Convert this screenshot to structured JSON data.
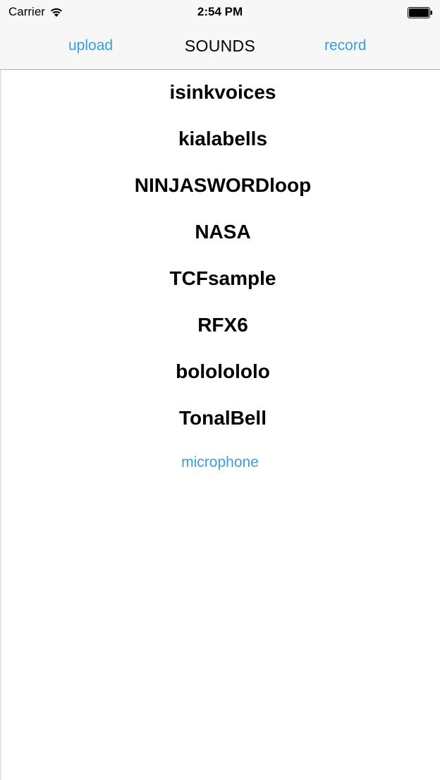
{
  "status_bar": {
    "carrier": "Carrier",
    "time": "2:54 PM",
    "wifi_icon": "wifi-icon",
    "battery_icon": "battery-icon"
  },
  "nav_bar": {
    "left_label": "upload",
    "title": "SOUNDS",
    "right_label": "record"
  },
  "sounds": [
    {
      "name": "isinkvoices"
    },
    {
      "name": "kialabells"
    },
    {
      "name": "NINJASWORDloop"
    },
    {
      "name": "NASA"
    },
    {
      "name": "TCFsample"
    },
    {
      "name": "RFX6"
    },
    {
      "name": "bololololo"
    },
    {
      "name": "TonalBell"
    }
  ],
  "microphone_label": "microphone",
  "colors": {
    "accent": "#3b9ddd",
    "bar_background": "#f7f7f7",
    "text": "#000000"
  }
}
